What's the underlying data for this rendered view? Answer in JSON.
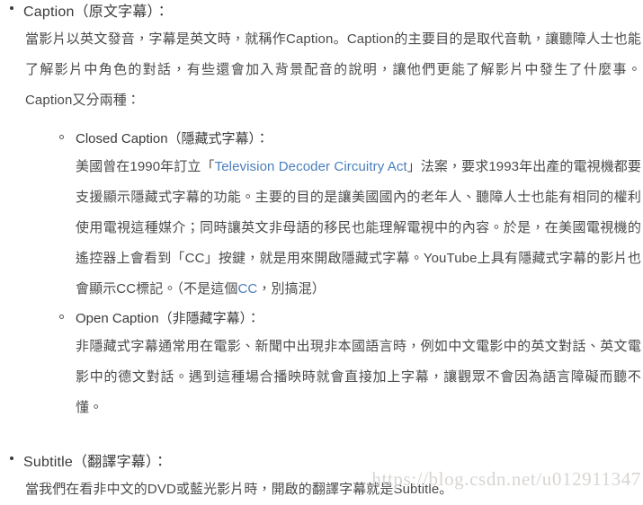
{
  "document": {
    "background_color": "#ffffff",
    "text_color": "#4a4a4a",
    "heading_color": "#3a3a3a",
    "link_color": "#4a7ebb",
    "watermark_color": "#d8d5d2"
  },
  "sections": {
    "caption": {
      "heading": "Caption（原文字幕）：",
      "paragraph_1": "當影片以英文發音，字幕是英文時，就稱作Caption。Caption的主要目的是取代音軌，讓聽障人士也能了解影片中角色的對話，有些還會加入背景配音的說明，讓他們更能了解影片中發生了什麼事。Caption又分兩種：",
      "closed_caption": {
        "heading": "Closed Caption（隱藏式字幕）：",
        "text_before_link": "美國曾在1990年訂立「",
        "link_text": "Television Decoder Circuitry Act",
        "text_after_link": "」法案，要求1993年出產的電視機都要支援顯示隱藏式字幕的功能。主要的目的是讓美國國內的老年人、聽障人士也能有相同的權利使用電視這種媒介；同時讓英文非母語的移民也能理解電視中的內容。於是，在美國電視機的遙控器上會看到「CC」按鍵，就是用來開啟隱藏式字幕。YouTube上具有隱藏式字幕的影片也會顯示CC標記。（不是這個",
        "inline_link_text": "CC",
        "text_tail": "，別搞混）"
      },
      "open_caption": {
        "heading": "Open Caption（非隱藏字幕）：",
        "paragraph": "非隱藏式字幕通常用在電影、新聞中出現非本國語言時，例如中文電影中的英文對話、英文電影中的德文對話。遇到這種場合播映時就會直接加上字幕，讓觀眾不會因為語言障礙而聽不懂。"
      }
    },
    "subtitle": {
      "heading": "Subtitle（翻譯字幕）：",
      "paragraph": "當我們在看非中文的DVD或藍光影片時，開啟的翻譯字幕就是Subtitle。"
    }
  },
  "watermark": {
    "text": "https://blog.csdn.net/u012911347"
  }
}
